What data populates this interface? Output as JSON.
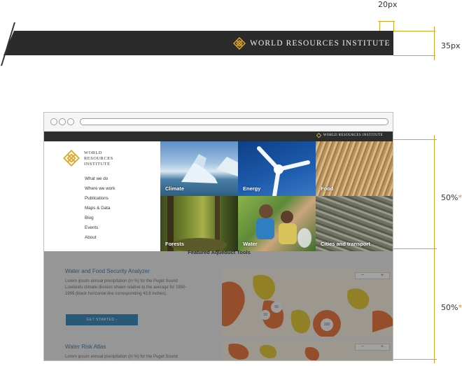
{
  "spec": {
    "brand_text": "WORLD RESOURCES INSTITUTE",
    "spacing_label": "20px",
    "height_label": "35px",
    "section_top_label": "50%",
    "section_bottom_label": "50%",
    "asterisk": "*",
    "accent_color": "#d9a520"
  },
  "browser": {
    "topstrip_brand": "WORLD RESOURCES INSTITUTE",
    "logo_lines": [
      "WORLD",
      "RESOURCES",
      "INSTITUTE"
    ],
    "nav": [
      "What we do",
      "Where we work",
      "Publications",
      "Maps & Data",
      "Blog",
      "Events",
      "About"
    ],
    "tiles": [
      "Climate",
      "Energy",
      "Food",
      "Forests",
      "Water",
      "Cities and transport"
    ],
    "featured_title": "Featured Aqueduct Tools",
    "card1": {
      "title": "Water and Food Security Analyzer",
      "description": "Lorem ipsum annual precipitation (in %) for the Puget Sound Lowlands climate division shown relative to the average for 1950-1999 (black horizontal line corresponding 43.6 inches).",
      "cta": "GET STARTED",
      "cta_icon": "chevron-right-icon"
    },
    "card2": {
      "title": "Water Risk Atlas",
      "description": "Lorem ipsum annual precipitation (in %) for the Puget Sound"
    },
    "map_markers": [
      "50",
      "10",
      "200"
    ],
    "zoom_minus": "−",
    "zoom_plus": "+"
  }
}
